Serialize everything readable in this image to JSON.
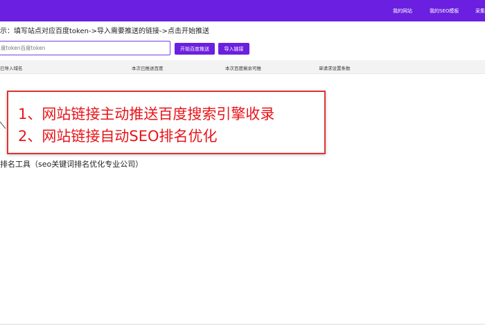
{
  "header": {
    "nav": [
      "我的网站",
      "我的SEO模板",
      "采集"
    ],
    "color": "#6b1fe0"
  },
  "hint": "示：填写站点对应百度token->导入需要推送的链接->点击开始推送",
  "token_input": {
    "placeholder": "度token百度token"
  },
  "buttons": {
    "start": "开始百度推送",
    "import": "导入链接"
  },
  "table": {
    "columns": [
      "已导入域名",
      "本次已推送百度",
      "本次百度剩余可推",
      "单请求设置条数"
    ]
  },
  "callout": {
    "lines": [
      "1、网站链接主动推送百度搜索引擎收录",
      "2、网站链接自动SEO排名优化"
    ],
    "color": "#e8141a"
  },
  "bottom_title": "排名工具（seo关键词排名优化专业公司）"
}
